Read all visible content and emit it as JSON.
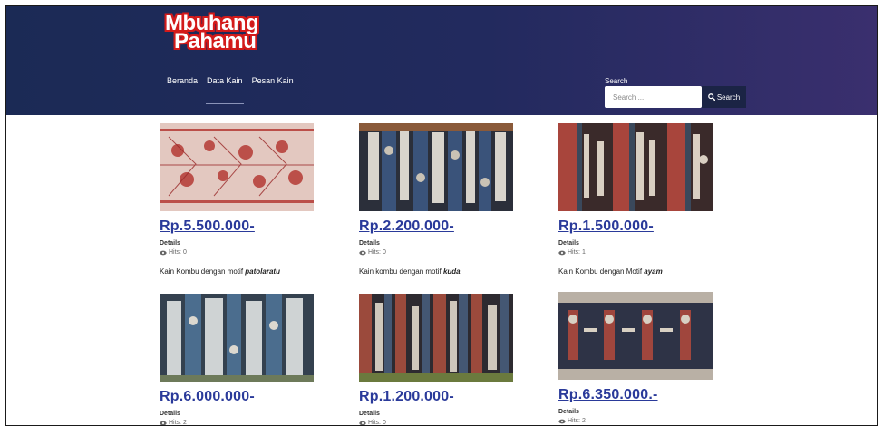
{
  "site": {
    "logo_line1": "Mbuhang",
    "logo_line2": "Pahamu"
  },
  "nav": {
    "items": [
      {
        "label": "Beranda"
      },
      {
        "label": "Data Kain"
      },
      {
        "label": "Pesan Kain"
      }
    ]
  },
  "search": {
    "label": "Search",
    "placeholder": "Search ...",
    "button_label": "Search"
  },
  "products": [
    {
      "price": "Rp.5.500.000-",
      "details": "Details",
      "hits": "Hits: 0",
      "desc_prefix": "Kain Kombu dengan motif ",
      "desc_motif": "patolaratu"
    },
    {
      "price": "Rp.2.200.000-",
      "details": "Details",
      "hits": "Hits: 0",
      "desc_prefix": "Kain kombu dengan motif ",
      "desc_motif": "kuda"
    },
    {
      "price": "Rp.1.500.000-",
      "details": "Details",
      "hits": "Hits: 1",
      "desc_prefix": "Kain Kombu dengan Motif ",
      "desc_motif": "ayam"
    },
    {
      "price": "Rp.6.000.000-",
      "details": "Details",
      "hits": "Hits: 2"
    },
    {
      "price": "Rp.1.200.000-",
      "details": "Details",
      "hits": "Hits: 0"
    },
    {
      "price": "Rp.6.350.000.-",
      "details": "Details",
      "hits": "Hits: 2"
    }
  ],
  "colors": {
    "header_start": "#1b2a55",
    "header_end": "#3a2f6e",
    "logo_outline": "#d31a1a",
    "price_link": "#2a3a9a",
    "search_button": "#1b2445"
  },
  "icons": {
    "search": "magnifier-icon",
    "hits": "eye-icon"
  }
}
